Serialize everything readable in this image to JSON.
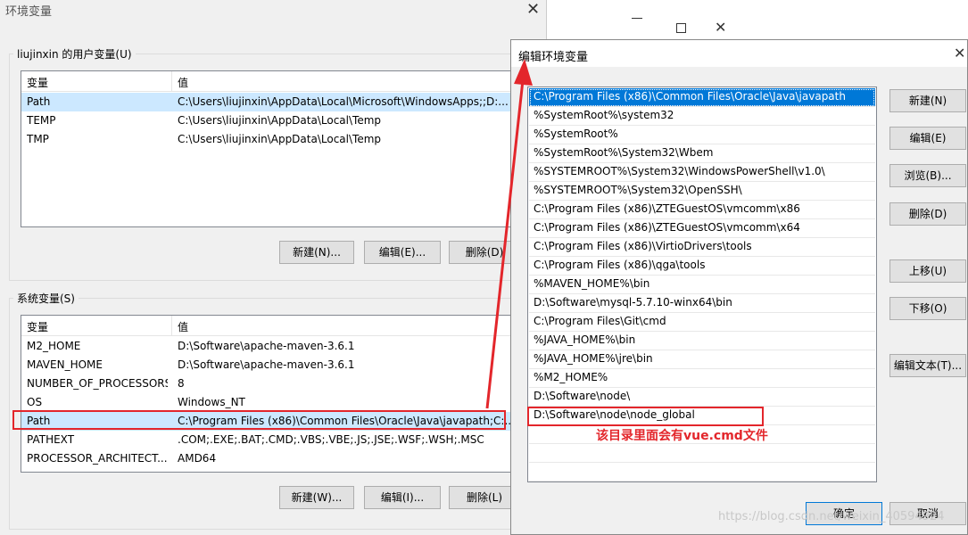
{
  "env_dialog": {
    "title": "环境变量",
    "user_group_label": "liujinxin 的用户变量(U)",
    "columns": [
      "变量",
      "值"
    ],
    "user_vars": [
      {
        "name": "Path",
        "value": "C:\\Users\\liujinxin\\AppData\\Local\\Microsoft\\WindowsApps;;D:..."
      },
      {
        "name": "TEMP",
        "value": "C:\\Users\\liujinxin\\AppData\\Local\\Temp"
      },
      {
        "name": "TMP",
        "value": "C:\\Users\\liujinxin\\AppData\\Local\\Temp"
      }
    ],
    "user_buttons": {
      "new": "新建(N)...",
      "edit": "编辑(E)...",
      "delete": "删除(D)"
    },
    "system_group_label": "系统变量(S)",
    "system_vars": [
      {
        "name": "M2_HOME",
        "value": "D:\\Software\\apache-maven-3.6.1"
      },
      {
        "name": "MAVEN_HOME",
        "value": "D:\\Software\\apache-maven-3.6.1"
      },
      {
        "name": "NUMBER_OF_PROCESSORS",
        "value": "8"
      },
      {
        "name": "OS",
        "value": "Windows_NT"
      },
      {
        "name": "Path",
        "value": "C:\\Program Files (x86)\\Common Files\\Oracle\\Java\\javapath;C:..."
      },
      {
        "name": "PATHEXT",
        "value": ".COM;.EXE;.BAT;.CMD;.VBS;.VBE;.JS;.JSE;.WSF;.WSH;.MSC"
      },
      {
        "name": "PROCESSOR_ARCHITECT...",
        "value": "AMD64"
      }
    ],
    "system_buttons": {
      "new": "新建(W)...",
      "edit": "编辑(I)...",
      "delete": "删除(L)"
    }
  },
  "edit_dialog": {
    "title": "编辑环境变量",
    "paths": [
      "C:\\Program Files (x86)\\Common Files\\Oracle\\Java\\javapath",
      "%SystemRoot%\\system32",
      "%SystemRoot%",
      "%SystemRoot%\\System32\\Wbem",
      "%SYSTEMROOT%\\System32\\WindowsPowerShell\\v1.0\\",
      "%SYSTEMROOT%\\System32\\OpenSSH\\",
      "C:\\Program Files (x86)\\ZTEGuestOS\\vmcomm\\x86",
      "C:\\Program Files (x86)\\ZTEGuestOS\\vmcomm\\x64",
      "C:\\Program Files (x86)\\VirtioDrivers\\tools",
      "C:\\Program Files (x86)\\qga\\tools",
      "%MAVEN_HOME%\\bin",
      "D:\\Software\\mysql-5.7.10-winx64\\bin",
      "C:\\Program Files\\Git\\cmd",
      "%JAVA_HOME%\\bin",
      "%JAVA_HOME%\\jre\\bin",
      "%M2_HOME%",
      "D:\\Software\\node\\",
      "D:\\Software\\node\\node_global"
    ],
    "buttons": {
      "new": "新建(N)",
      "edit": "编辑(E)",
      "browse": "浏览(B)...",
      "delete": "删除(D)",
      "move_up": "上移(U)",
      "move_down": "下移(O)",
      "edit_text": "编辑文本(T)..."
    },
    "ok": "确定",
    "cancel": "取消"
  },
  "annotation": "该目录里面会有vue.cmd文件",
  "watermark": "https://blog.csdn.net/weixin_40594924",
  "colors": {
    "selection": "#0078d7",
    "annotation": "#e3262b",
    "row_highlight": "#cce8ff"
  }
}
